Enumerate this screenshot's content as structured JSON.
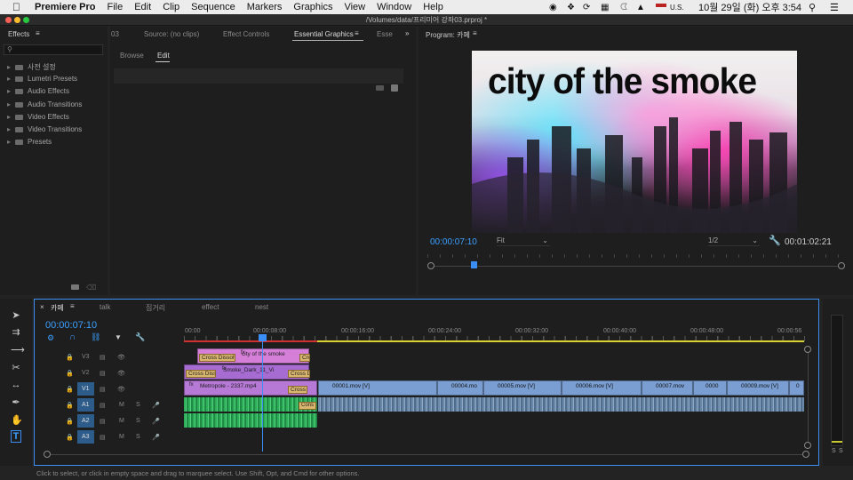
{
  "menubar": {
    "app": "Premiere Pro",
    "items": [
      "File",
      "Edit",
      "Clip",
      "Sequence",
      "Markers",
      "Graphics",
      "View",
      "Window",
      "Help"
    ],
    "status": {
      "locale": "U.S.",
      "datetime": "10월 29일 (화) 오후 3:54"
    }
  },
  "window": {
    "title": "/Volumes/data/프리미어 강좌03.prproj *"
  },
  "effects": {
    "title": "Effects",
    "search_placeholder": "",
    "items": [
      "사전 설정",
      "Lumetri Presets",
      "Audio Effects",
      "Audio Transitions",
      "Video Effects",
      "Video Transitions",
      "Presets"
    ]
  },
  "source_tabs": {
    "prev": "03",
    "tabs": [
      "Source: (no clips)",
      "Effect Controls",
      "Essential Graphics",
      "Esse"
    ],
    "active": "Essential Graphics"
  },
  "eg": {
    "browse": "Browse",
    "edit": "Edit"
  },
  "program": {
    "title": "Program: 카페",
    "overlay_text": "city of the smoke",
    "timecode": "00:00:07:10",
    "fit": "Fit",
    "resolution": "1/2",
    "duration": "00:01:02:21"
  },
  "timeline": {
    "tabs": [
      "카페",
      "talk",
      "집거리",
      "effect",
      "nest"
    ],
    "timecode": "00:00:07:10",
    "ruler": [
      "00:00",
      "00:00:08:00",
      "00:00:16:00",
      "00:00:24:00",
      "00:00:32:00",
      "00:00:40:00",
      "00:00:48:00",
      "00:00:56"
    ],
    "tracks": {
      "video": [
        "V3",
        "V2",
        "V1"
      ],
      "audio": [
        "A1",
        "A2",
        "A3"
      ]
    },
    "clips": {
      "v3": [
        "Cross Dissolv",
        "city of the smoke",
        "Cross"
      ],
      "v2": [
        "Cross Disso",
        "Smoke_Dark_11_Vi",
        "Cross D"
      ],
      "v1": [
        "Metropole - 2337.mp4",
        "Cross",
        "00001.mov [V]",
        "00004.mo",
        "00005.mov [V]",
        "00006.mov [V]",
        "00007.mov",
        "0000",
        "00009.mov [V]",
        "0"
      ]
    },
    "track_letters": {
      "mute": "M",
      "solo": "S"
    }
  },
  "status_bar": "Click to select, or click in empty space and drag to marquee select. Use Shift, Opt, and Cmd for other options.",
  "meter": {
    "labels": [
      "S",
      "S"
    ]
  }
}
